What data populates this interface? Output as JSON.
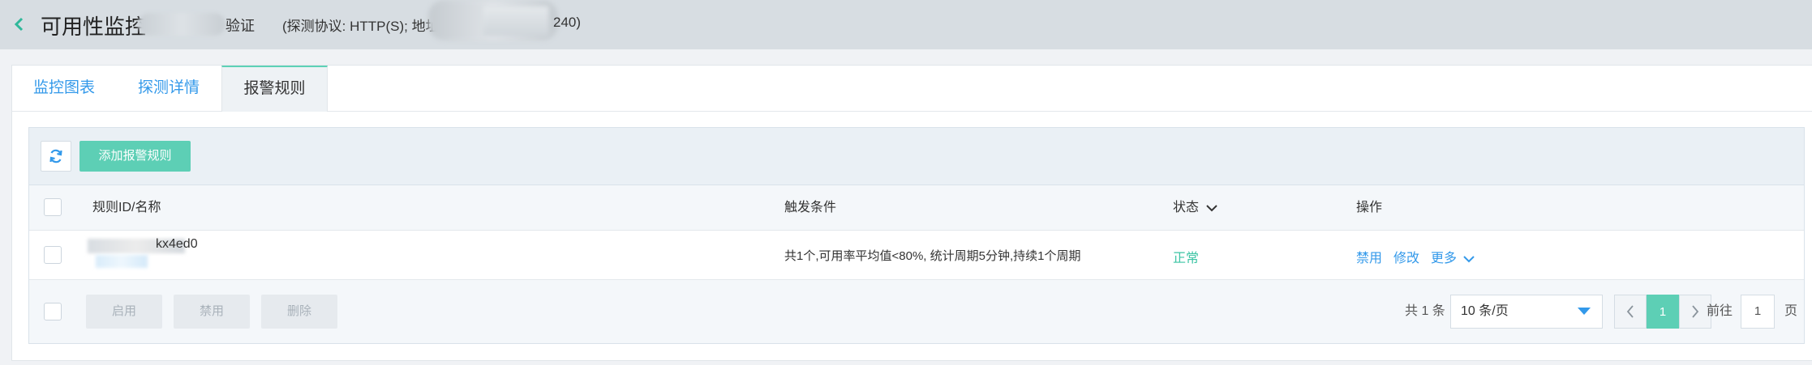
{
  "header": {
    "title": "可用性监控",
    "title_suffix": "验证",
    "meta": "(探测协议: HTTP(S); 地址",
    "meta_tail": "240)"
  },
  "tabs": [
    {
      "label": "监控图表",
      "active": false
    },
    {
      "label": "探测详情",
      "active": false
    },
    {
      "label": "报警规则",
      "active": true
    }
  ],
  "toolbar": {
    "refresh_icon": "refresh-icon",
    "add_label": "添加报警规则"
  },
  "table": {
    "columns": [
      "规则ID/名称",
      "触发条件",
      "状态",
      "操作"
    ],
    "rows": [
      {
        "id_suffix": "kx4ed0",
        "condition": "共1个,可用率平均值<80%, 统计周期5分钟,持续1个周期",
        "status": "正常",
        "actions": [
          "禁用",
          "修改",
          "更多"
        ]
      }
    ]
  },
  "footer": {
    "bulk": [
      "启用",
      "禁用",
      "删除"
    ],
    "total": "共 1 条",
    "page_size": "10 条/页",
    "current_page": "1",
    "goto_label": "前往",
    "goto_value": "1",
    "page_unit": "页"
  },
  "colors": {
    "accent_teal": "#5dcfb5",
    "link_blue": "#3399ea",
    "status_ok": "#3cc4a4"
  }
}
